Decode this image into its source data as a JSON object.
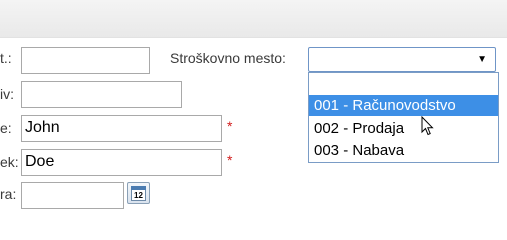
{
  "form": {
    "row1_label": "t.:",
    "row2_label": "iv:",
    "first_name_label": "e:",
    "first_name_value": "John",
    "last_name_label": "ek:",
    "last_name_value": "Doe",
    "row5_label": "ra:",
    "required_marker": "*",
    "calendar_day": "12"
  },
  "cost_center": {
    "label": "Stroškovno mesto:",
    "selected_value": "",
    "arrow": "▼",
    "options": [
      "",
      "001 - Računovodstvo",
      "002 - Prodaja",
      "003 - Nabava"
    ],
    "highlighted_index": 1
  },
  "icons": {
    "calendar": "calendar-icon",
    "cursor": "mouse-pointer-icon"
  },
  "colors": {
    "highlight": "#3d8fe6",
    "required": "#d11a1a",
    "select_border": "#6f95c7"
  }
}
